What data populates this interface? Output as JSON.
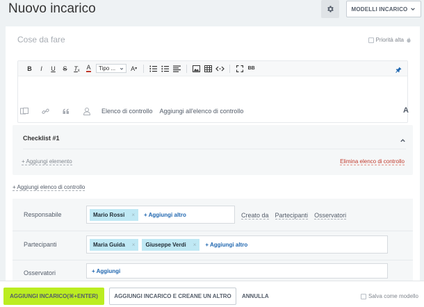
{
  "header": {
    "title": "Nuovo incarico",
    "templates_label": "MODELLI INCARICO"
  },
  "task": {
    "title_placeholder": "Cose da fare",
    "priority_label": "Priorità alta"
  },
  "toolbar": {
    "bold": "B",
    "italic": "I",
    "underline": "U",
    "strike": "S",
    "clear_format": "T",
    "font_color": "A",
    "font_style": "Tipo ...",
    "font_size": "A",
    "bbcode": "BB"
  },
  "attachments": {
    "checklist_link": "Elenco di controllo",
    "add_to_checklist_link": "Aggiungi all'elenco di controllo",
    "font_toggle": "A"
  },
  "checklist": {
    "title": "Checklist #1",
    "add_item": "+ Aggiungi elemento",
    "delete": "Elimina elenco di controllo"
  },
  "add_checklist": "+ Aggiungi elenco di controllo",
  "people": {
    "responsible": {
      "label": "Responsabile",
      "chips": [
        "Mario Rossi"
      ],
      "add_more": "Aggiungi altro"
    },
    "roles": [
      "Creato da",
      "Partecipanti",
      "Osservatori"
    ],
    "participants": {
      "label": "Partecipanti",
      "chips": [
        "Maria Guida",
        "Giuseppe Verdi"
      ],
      "add_more": "Aggiungi altro"
    },
    "observers": {
      "label": "Osservatori",
      "add": "Aggiungi"
    }
  },
  "footer": {
    "add_task": "AGGIUNGI INCARICO(⌘+ENTER)",
    "add_and_new": "AGGIUNGI INCARICO E CREANE UN ALTRO",
    "cancel": "ANNULLA",
    "save_as_template": "Salva come modello"
  },
  "colors": {
    "accent_green": "#bbed21",
    "link_blue": "#2067b0",
    "chip_blue": "#bfe8f4",
    "danger_red": "#c0392b"
  }
}
